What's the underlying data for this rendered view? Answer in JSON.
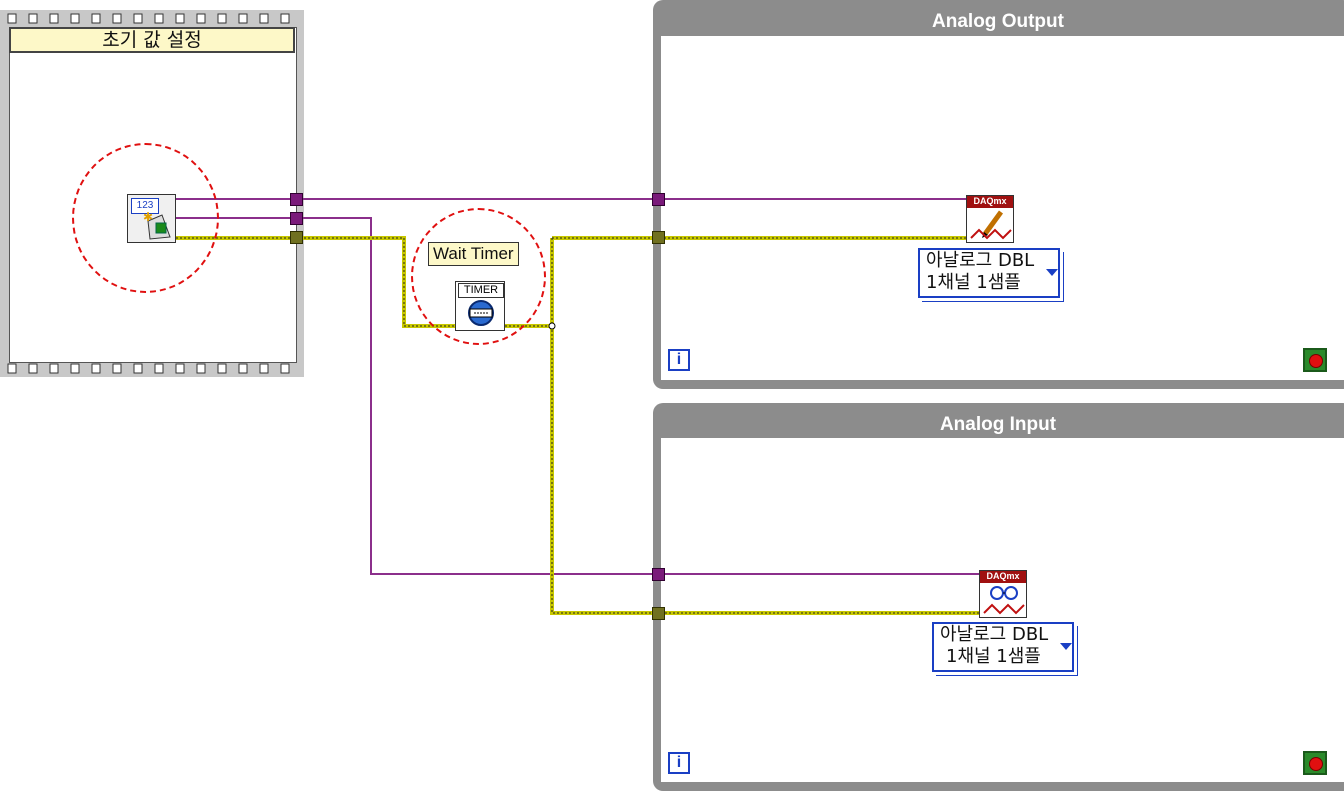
{
  "sequence": {
    "label": "초기 값 설정"
  },
  "const_node": {
    "label": "123"
  },
  "wait_timer": {
    "tooltip": "Wait Timer",
    "label": "TIMER"
  },
  "loops": [
    {
      "title": "Analog Output",
      "iteration": "i",
      "daq": {
        "header": "DAQmx",
        "line1": "아날로그 DBL",
        "line2": "1채널 1샘플"
      }
    },
    {
      "title": "Analog Input",
      "iteration": "i",
      "daq": {
        "header": "DAQmx",
        "line1": "아날로그 DBL",
        "line2": "1채널 1샘플"
      }
    }
  ],
  "colors": {
    "wire_purple": "#8b2f8b",
    "wire_yellow": "#c8c800",
    "annotation_red": "#e01010",
    "loop_frame": "#8c8c8c"
  }
}
